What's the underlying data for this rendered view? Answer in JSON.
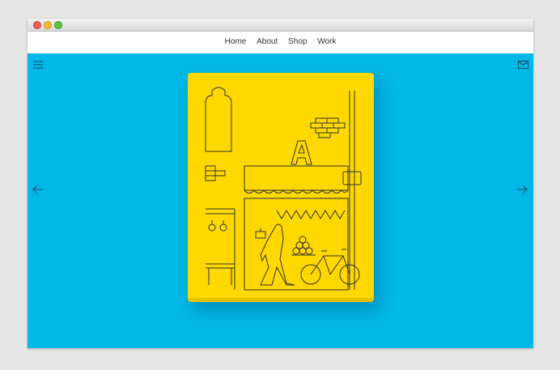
{
  "nav": {
    "items": [
      {
        "label": "Home"
      },
      {
        "label": "About"
      },
      {
        "label": "Shop"
      },
      {
        "label": "Work"
      }
    ]
  },
  "icons": {
    "menu": "hamburger-menu-icon",
    "mail": "envelope-icon",
    "prev": "arrow-left-icon",
    "next": "arrow-right-icon"
  },
  "book": {
    "illustration_letter": "A"
  },
  "colors": {
    "stage_bg": "#00b8e6",
    "book_cover": "#ffd800",
    "line_art": "#333333"
  }
}
